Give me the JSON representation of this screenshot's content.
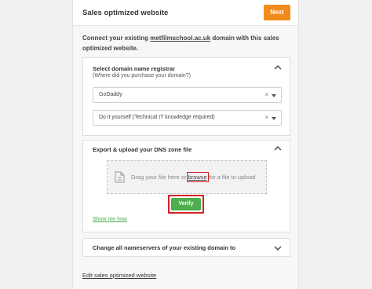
{
  "header": {
    "title": "Sales optimized website",
    "next_label": "Next"
  },
  "intro": {
    "prefix": "Connect your existing ",
    "domain": "metfilmschool.ac.uk",
    "suffix": " domain with this sales optimized website."
  },
  "registrar_section": {
    "heading": "Select domain name registrar",
    "subheading": "(Where did you purchase your domain?)",
    "registrar_value": "GoDaddy",
    "method_value": "Do it yourself (Technical IT knowledge required)",
    "clear_glyph": "×"
  },
  "dns_section": {
    "heading": "Export & upload your DNS zone file",
    "drop_prefix": "Drag your file here or ",
    "browse_label": "browse",
    "drop_suffix": " for a file to upload",
    "verify_label": "Verify",
    "show_me_how": "Show me how"
  },
  "nameservers_section": {
    "heading": "Change all nameservers of your existing domain to"
  },
  "footer": {
    "edit_link": "Edit sales optimized website"
  },
  "colors": {
    "accent_orange": "#f28a1c",
    "verify_green": "#4cae4c",
    "highlight_red": "#d62222"
  },
  "icons": [
    "chevron-up-icon",
    "chevron-down-icon",
    "file-upload-icon",
    "clear-icon",
    "caret-down-icon"
  ]
}
